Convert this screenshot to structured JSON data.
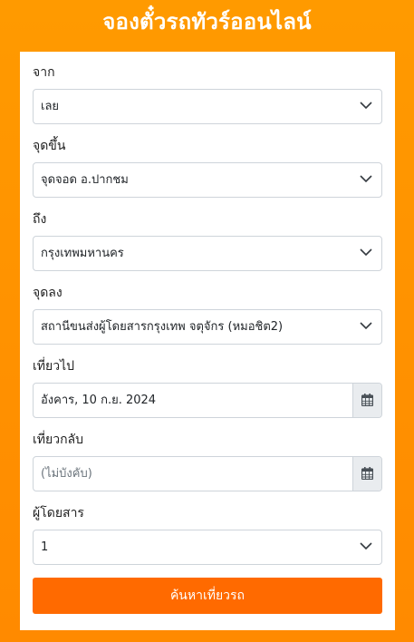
{
  "page": {
    "title": "จองตั๋วรถทัวร์ออนไลน์"
  },
  "form": {
    "from": {
      "label": "จาก",
      "value": "เลย"
    },
    "pickup": {
      "label": "จุดขึ้น",
      "value": "จุดจอด อ.ปากชม"
    },
    "to": {
      "label": "ถึง",
      "value": "กรุงเทพมหานคร"
    },
    "dropoff": {
      "label": "จุดลง",
      "value": "สถานีขนส่งผู้โดยสารกรุงเทพ จตุจักร (หมอชิต2)"
    },
    "depart": {
      "label": "เที่ยวไป",
      "value": "อังคาร, 10 ก.ย. 2024"
    },
    "return": {
      "label": "เที่ยวกลับ",
      "placeholder": "(ไม่บังคับ)"
    },
    "passengers": {
      "label": "ผู้โดยสาร",
      "value": "1"
    },
    "search_label": "ค้นหาเที่ยวรถ"
  },
  "colors": {
    "accent": "#ff6a00",
    "background": "#ff9a00"
  },
  "icons": {
    "select": "chevron-down-icon",
    "date": "calendar-icon"
  }
}
